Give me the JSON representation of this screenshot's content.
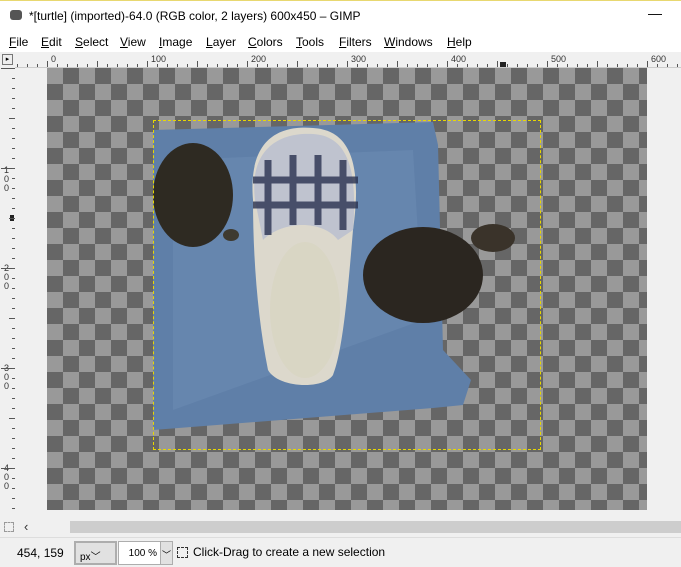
{
  "window": {
    "title": "*[turtle] (imported)-64.0 (RGB color, 2 layers) 600x450 – GIMP",
    "minimize": "—"
  },
  "menu": [
    "File",
    "Edit",
    "Select",
    "View",
    "Image",
    "Layer",
    "Colors",
    "Tools",
    "Filters",
    "Windows",
    "Help"
  ],
  "ruler_top": [
    "0",
    "100",
    "200",
    "300",
    "400",
    "500",
    "600"
  ],
  "ruler_left": [
    "1\n0\n0",
    "2\n0\n0",
    "3\n0\n0",
    "4\n0\n0"
  ],
  "status": {
    "coords": "454, 159",
    "unit": "px",
    "zoom": "100 %",
    "message": "Click-Drag to create a new selection"
  },
  "colors": {
    "selection": "#e8d800",
    "towel": "#5f7fa8"
  }
}
